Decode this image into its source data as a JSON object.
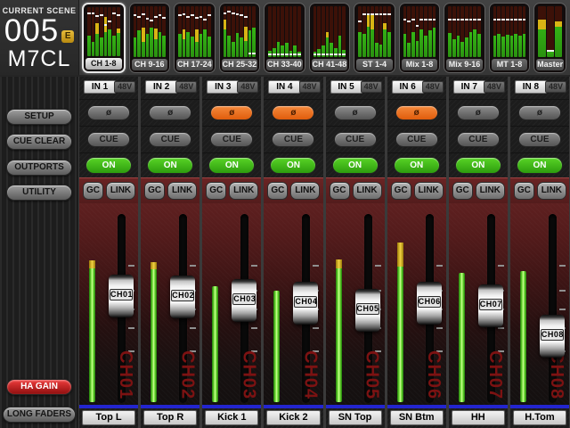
{
  "scene": {
    "label": "CURRENT SCENE",
    "number": "005",
    "edit_flag": "E",
    "console": "M7CL"
  },
  "sidebar": {
    "setup": "SETUP",
    "cue_clear": "CUE CLEAR",
    "outports": "OUTPORTS",
    "utility": "UTILITY",
    "ha_gain": "HA GAIN",
    "long_faders": "LONG FADERS"
  },
  "strip_controls": {
    "phantom": "48V",
    "phase": "ø",
    "cue": "CUE",
    "on": "ON",
    "gain_comp": "GC",
    "link": "LINK"
  },
  "fader_scale_ticks": [
    0.27,
    0.4,
    0.5,
    0.6,
    0.72
  ],
  "tabs": [
    {
      "label": "CH 1-8",
      "selected": true,
      "bars": [
        {
          "g": 0.42,
          "y": 0,
          "d": 0.85
        },
        {
          "g": 0.3,
          "y": 0,
          "d": 0.85
        },
        {
          "g": 0.45,
          "y": 0.23,
          "d": 0.8
        },
        {
          "g": 0.38,
          "y": 0,
          "d": 0.82
        },
        {
          "g": 0.5,
          "y": 0.3,
          "d": 0.62
        },
        {
          "g": 0.55,
          "y": 0,
          "d": 0.7
        },
        {
          "g": 0.42,
          "y": 0,
          "d": 0.85
        },
        {
          "g": 0.48,
          "y": 0.08,
          "d": 0.82
        }
      ]
    },
    {
      "label": "CH 9-16",
      "selected": false,
      "bars": [
        {
          "g": 0.38,
          "y": 0,
          "d": 0.8
        },
        {
          "g": 0.52,
          "y": 0,
          "d": 0.78
        },
        {
          "g": 0.3,
          "y": 0.28,
          "d": 0.82
        },
        {
          "g": 0.45,
          "y": 0,
          "d": 0.74
        },
        {
          "g": 0.58,
          "y": 0,
          "d": 0.7
        },
        {
          "g": 0.35,
          "y": 0.22,
          "d": 0.78
        },
        {
          "g": 0.5,
          "y": 0,
          "d": 0.8
        },
        {
          "g": 0.42,
          "y": 0,
          "d": 0.76
        }
      ]
    },
    {
      "label": "CH 17-24",
      "selected": false,
      "bars": [
        {
          "g": 0.45,
          "y": 0,
          "d": 0.8
        },
        {
          "g": 0.35,
          "y": 0.2,
          "d": 0.82
        },
        {
          "g": 0.5,
          "y": 0,
          "d": 0.78
        },
        {
          "g": 0.4,
          "y": 0,
          "d": 0.8
        },
        {
          "g": 0.3,
          "y": 0.25,
          "d": 0.75
        },
        {
          "g": 0.45,
          "y": 0,
          "d": 0.78
        },
        {
          "g": 0.55,
          "y": 0,
          "d": 0.72
        },
        {
          "g": 0.4,
          "y": 0,
          "d": 0.8
        }
      ]
    },
    {
      "label": "CH 25-32",
      "selected": false,
      "bars": [
        {
          "g": 0.55,
          "y": 0.18,
          "d": 0.85
        },
        {
          "g": 0.42,
          "y": 0,
          "d": 0.88
        },
        {
          "g": 0.3,
          "y": 0,
          "d": 0.85
        },
        {
          "g": 0.48,
          "y": 0,
          "d": 0.82
        },
        {
          "g": 0.38,
          "y": 0,
          "d": 0.8
        },
        {
          "g": 0.32,
          "y": 0.28,
          "d": 0.78
        },
        {
          "g": 0.52,
          "y": 0,
          "d": 0.05
        },
        {
          "g": 0.58,
          "y": 0,
          "d": 0.05
        }
      ]
    },
    {
      "label": "CH 33-40",
      "selected": false,
      "bars": [
        {
          "g": 0.12,
          "y": 0,
          "d": 0.04
        },
        {
          "g": 0.18,
          "y": 0,
          "d": 0.04
        },
        {
          "g": 0.3,
          "y": 0,
          "d": 0.04
        },
        {
          "g": 0.22,
          "y": 0,
          "d": 0.04
        },
        {
          "g": 0.28,
          "y": 0,
          "d": 0.04
        },
        {
          "g": 0.12,
          "y": 0,
          "d": 0.04
        },
        {
          "g": 0.22,
          "y": 0,
          "d": 0.04
        },
        {
          "g": 0.1,
          "y": 0,
          "d": 0.04
        }
      ]
    },
    {
      "label": "CH 41-48",
      "selected": false,
      "bars": [
        {
          "g": 0.1,
          "y": 0,
          "d": 0.04
        },
        {
          "g": 0.15,
          "y": 0,
          "d": 0.04
        },
        {
          "g": 0.22,
          "y": 0,
          "d": 0.04
        },
        {
          "g": 0.38,
          "y": 0.12,
          "d": 0.04
        },
        {
          "g": 0.28,
          "y": 0,
          "d": 0.04
        },
        {
          "g": 0.18,
          "y": 0,
          "d": 0.04
        },
        {
          "g": 0.42,
          "y": 0,
          "d": 0.04
        },
        {
          "g": 0.14,
          "y": 0,
          "d": 0.04
        }
      ]
    },
    {
      "label": "ST 1-4",
      "selected": false,
      "bars": [
        {
          "g": 0.5,
          "y": 0,
          "d": 0.68
        },
        {
          "g": 0.45,
          "y": 0,
          "d": 0.82
        },
        {
          "g": 0.6,
          "y": 0.25,
          "d": 0.82
        },
        {
          "g": 0.55,
          "y": 0.28,
          "d": 0.82
        },
        {
          "g": 0.28,
          "y": 0,
          "d": 0.82
        },
        {
          "g": 0.25,
          "y": 0,
          "d": 0.82
        },
        {
          "g": 0.55,
          "y": 0.12,
          "d": 0.82
        },
        {
          "g": 0.5,
          "y": 0,
          "d": 0.82
        }
      ]
    },
    {
      "label": "Mix 1-8",
      "selected": false,
      "bars": [
        {
          "g": 0.45,
          "y": 0,
          "d": 0.72
        },
        {
          "g": 0.28,
          "y": 0,
          "d": 0.68
        },
        {
          "g": 0.5,
          "y": 0,
          "d": 0.72
        },
        {
          "g": 0.32,
          "y": 0,
          "d": 0.6
        },
        {
          "g": 0.55,
          "y": 0,
          "d": 0.72
        },
        {
          "g": 0.42,
          "y": 0,
          "d": 0.72
        },
        {
          "g": 0.52,
          "y": 0,
          "d": 0.72
        },
        {
          "g": 0.58,
          "y": 0,
          "d": 0.72
        }
      ]
    },
    {
      "label": "Mix 9-16",
      "selected": false,
      "bars": [
        {
          "g": 0.48,
          "y": 0,
          "d": 0.72
        },
        {
          "g": 0.35,
          "y": 0,
          "d": 0.72
        },
        {
          "g": 0.42,
          "y": 0,
          "d": 0.72
        },
        {
          "g": 0.3,
          "y": 0,
          "d": 0.72
        },
        {
          "g": 0.38,
          "y": 0,
          "d": 0.72
        },
        {
          "g": 0.5,
          "y": 0,
          "d": 0.72
        },
        {
          "g": 0.55,
          "y": 0,
          "d": 0.72
        },
        {
          "g": 0.45,
          "y": 0,
          "d": 0.72
        }
      ]
    },
    {
      "label": "MT 1-8",
      "selected": false,
      "bars": [
        {
          "g": 0.42,
          "y": 0,
          "d": 0.72
        },
        {
          "g": 0.45,
          "y": 0,
          "d": 0.72
        },
        {
          "g": 0.4,
          "y": 0,
          "d": 0.72
        },
        {
          "g": 0.44,
          "y": 0,
          "d": 0.72
        },
        {
          "g": 0.42,
          "y": 0,
          "d": 0.72
        },
        {
          "g": 0.46,
          "y": 0,
          "d": 0.72
        },
        {
          "g": 0.43,
          "y": 0,
          "d": 0.72
        },
        {
          "g": 0.45,
          "y": 0,
          "d": 0.72
        }
      ]
    },
    {
      "label": "Master",
      "selected": false,
      "bars": [
        {
          "g": 0.55,
          "y": 0.18,
          "d": null
        },
        {
          "g": 0.12,
          "y": 0,
          "d": 0.1
        },
        {
          "g": 0.6,
          "y": 0.1,
          "d": null
        }
      ]
    }
  ],
  "channels": [
    {
      "input": "IN 1",
      "id": "CH01",
      "name": "Top L",
      "phase_inverted": false,
      "on": true,
      "fader": 0.434,
      "level": 0.75,
      "peak": 0.042
    },
    {
      "input": "IN 2",
      "id": "CH02",
      "name": "Top R",
      "phase_inverted": false,
      "on": true,
      "fader": 0.439,
      "level": 0.74,
      "peak": 0.04
    },
    {
      "input": "IN 3",
      "id": "CH03",
      "name": "Kick 1",
      "phase_inverted": true,
      "on": true,
      "fader": 0.458,
      "level": 0.613,
      "peak": 0
    },
    {
      "input": "IN 4",
      "id": "CH04",
      "name": "Kick 2",
      "phase_inverted": true,
      "on": true,
      "fader": 0.472,
      "level": 0.59,
      "peak": 0
    },
    {
      "input": "IN 5",
      "id": "CH05",
      "name": "SN Top",
      "phase_inverted": false,
      "on": true,
      "fader": 0.509,
      "level": 0.755,
      "peak": 0.047
    },
    {
      "input": "IN 6",
      "id": "CH06",
      "name": "SN Btm",
      "phase_inverted": true,
      "on": true,
      "fader": 0.472,
      "level": 0.844,
      "peak": 0.127
    },
    {
      "input": "IN 7",
      "id": "CH07",
      "name": "HH",
      "phase_inverted": false,
      "on": true,
      "fader": 0.486,
      "level": 0.684,
      "peak": 0
    },
    {
      "input": "IN 8",
      "id": "CH08",
      "name": "H.Tom",
      "phase_inverted": false,
      "on": true,
      "fader": 0.646,
      "level": 0.693,
      "peak": 0
    }
  ]
}
